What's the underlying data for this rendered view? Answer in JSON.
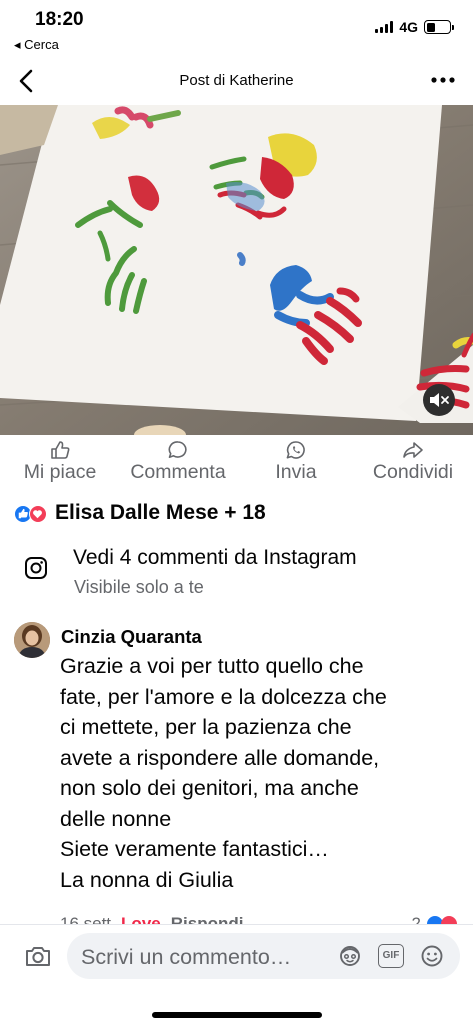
{
  "status_bar": {
    "time": "18:20",
    "back_label": "◂ Cerca",
    "network": "4G",
    "battery_level": 0.4
  },
  "nav": {
    "title": "Post di Katherine",
    "back_icon": "chevron-left-icon",
    "more_icon": "ellipsis-icon"
  },
  "media": {
    "mute_icon": "speaker-muted-icon"
  },
  "actions": {
    "like": "Mi piace",
    "comment": "Commenta",
    "send": "Invia",
    "share": "Condividi"
  },
  "reactions": {
    "names": "Elisa Dalle Mese + 18",
    "icons": [
      "like-reaction-icon",
      "love-reaction-icon"
    ],
    "colors": {
      "like": "#1877f2",
      "love": "#f33e58"
    }
  },
  "instagram": {
    "title": "Vedi 4 commenti da Instagram",
    "subtitle": "Visibile solo a te"
  },
  "comment": {
    "author": "Cinzia Quaranta",
    "lines": [
      "Grazie a voi per tutto quello che",
      "fate, per l'amore e la dolcezza che",
      "ci mettete, per la pazienza che",
      "avete a rispondere  alle domande,",
      "non solo dei genitori, ma anche",
      "delle nonne",
      "Siete veramente fantastici…",
      "La nonna di Giulia"
    ],
    "time": "16 sett",
    "love": "Love",
    "reply": "Rispondi",
    "reaction_count": "2"
  },
  "composer": {
    "placeholder": "Scrivi un commento…",
    "gif_label": "GIF"
  }
}
